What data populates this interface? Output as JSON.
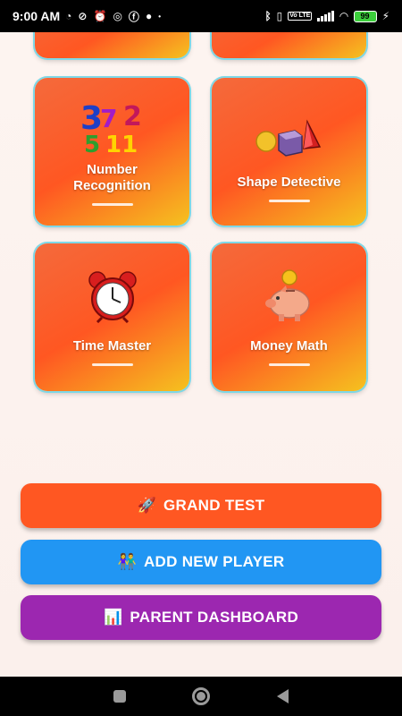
{
  "status_bar": {
    "time": "9:00 AM",
    "battery": "99",
    "icons": [
      "data-saver-icon",
      "no-sound-icon",
      "alarm-icon",
      "whatsapp-icon",
      "facebook-icon",
      "messenger-icon",
      "dot-icon"
    ],
    "right_icons": [
      "bluetooth-icon",
      "vibrate-icon",
      "volte-icon",
      "signal-icon",
      "wifi-icon",
      "battery-icon",
      "charging-icon"
    ],
    "volte": "Vo LTE"
  },
  "cards": [
    {
      "title": "",
      "icon": "partial-card"
    },
    {
      "title": "",
      "icon": "partial-card"
    },
    {
      "title": "Number Recognition",
      "line1": "Number",
      "line2": "Recognition",
      "icon": "numbers-icon"
    },
    {
      "title": "Shape Detective",
      "icon": "shapes-icon"
    },
    {
      "title": "Time Master",
      "icon": "alarm-clock-icon"
    },
    {
      "title": "Money Math",
      "icon": "piggy-bank-icon"
    }
  ],
  "numbers_art": {
    "d1": "3",
    "d2": "7",
    "d3": "2",
    "d4": "5",
    "d5": "11"
  },
  "buttons": {
    "grand_test": {
      "emoji": "🚀",
      "label": "GRAND TEST",
      "color": "#ff5722"
    },
    "add_player": {
      "emoji": "👫",
      "label": "ADD NEW PLAYER",
      "color": "#2196f3"
    },
    "parent_dashboard": {
      "emoji": "📊",
      "label": "PARENT DASHBOARD",
      "color": "#9c27b0"
    }
  },
  "colors": {
    "card_gradient_start": "#f46a3c",
    "card_gradient_end": "#f5c21f",
    "card_border": "#7fd8e6",
    "background": "#fdf3ef"
  }
}
